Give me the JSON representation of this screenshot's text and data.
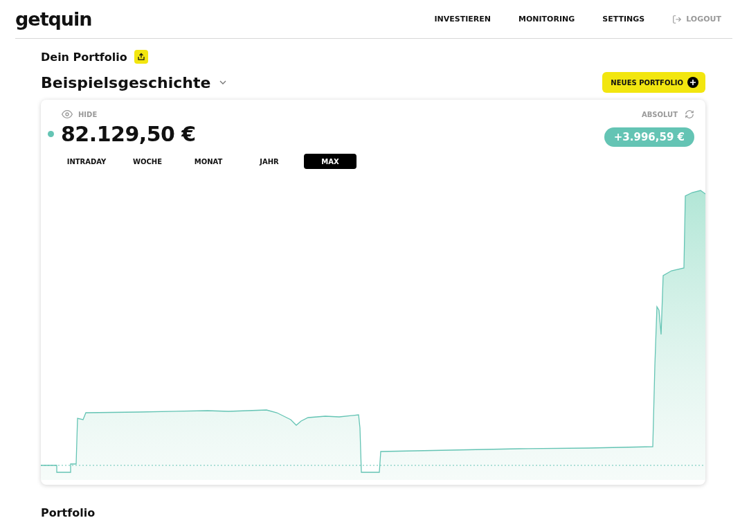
{
  "header": {
    "logo": "getquin",
    "nav": [
      {
        "label": "INVESTIEREN",
        "kind": "link"
      },
      {
        "label": "MONITORING",
        "kind": "link"
      },
      {
        "label": "SETTINGS",
        "kind": "link"
      },
      {
        "label": "LOGOUT",
        "kind": "logout"
      }
    ]
  },
  "portfolio": {
    "heading": "Dein Portfolio",
    "name": "Beispielsgeschichte",
    "new_button": "NEUES PORTFOLIO"
  },
  "card": {
    "hide_label": "HIDE",
    "mode_label": "ABSOLUT",
    "value": "82.129,50 €",
    "change": "+3.996,59 €",
    "ranges": [
      {
        "label": "INTRADAY",
        "selected": false
      },
      {
        "label": "WOCHE",
        "selected": false
      },
      {
        "label": "MONAT",
        "selected": false
      },
      {
        "label": "JAHR",
        "selected": false
      },
      {
        "label": "MAX",
        "selected": true
      }
    ]
  },
  "section_title": "Portfolio"
}
